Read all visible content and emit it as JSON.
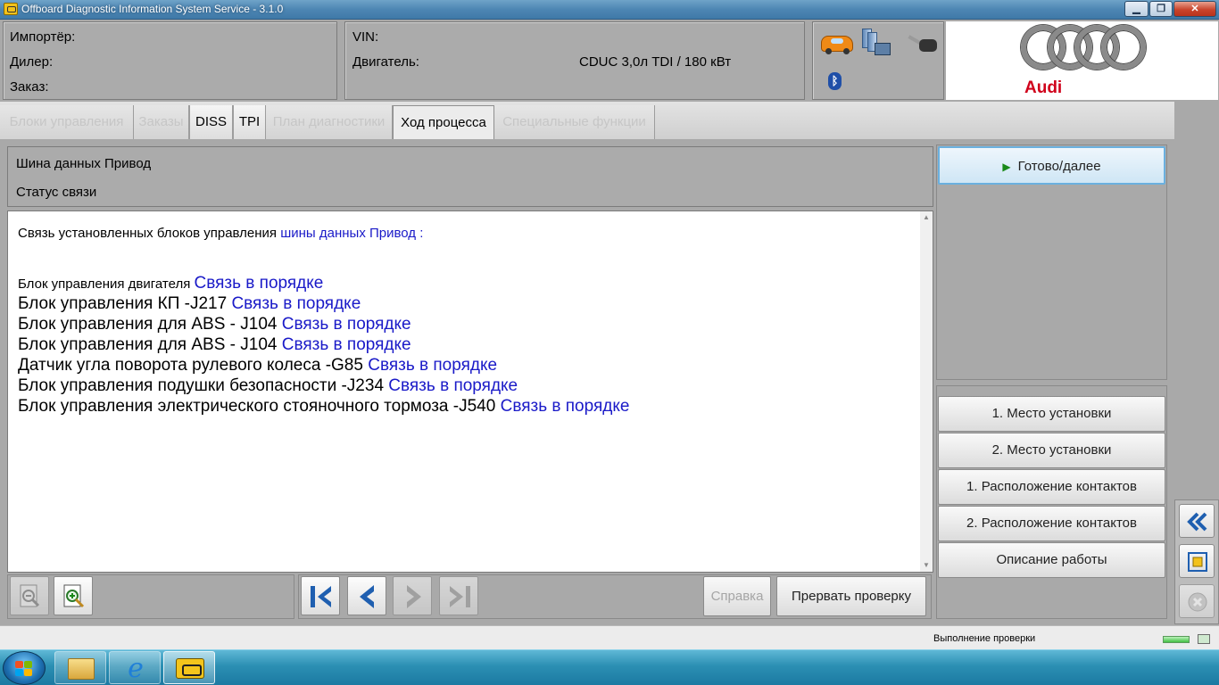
{
  "window": {
    "title": "Offboard Diagnostic Information System Service - 3.1.0",
    "min_label": "▁",
    "max_label": "❐",
    "close_label": "✕"
  },
  "header": {
    "importer_label": "Импортёр:",
    "dealer_label": "Дилер:",
    "order_label": "Заказ:",
    "vin_label": "VIN:",
    "engine_label": "Двигатель:",
    "engine_value": "CDUC 3,0л TDI / 180 кВт",
    "logo_text": "Audi",
    "icons": [
      "car-icon",
      "network-icon",
      "key-icon",
      "bluetooth-icon"
    ],
    "bluetooth_glyph": "ᛒ"
  },
  "tabs": [
    {
      "label": "Блоки управления",
      "state": "disabled"
    },
    {
      "label": "Заказы",
      "state": "disabled"
    },
    {
      "label": "DISS",
      "state": "enabled"
    },
    {
      "label": "TPI",
      "state": "enabled"
    },
    {
      "label": "План диагностики",
      "state": "disabled"
    },
    {
      "label": "Ход процесса",
      "state": "active"
    },
    {
      "label": "Специальные функции",
      "state": "disabled"
    }
  ],
  "info": {
    "title": "Шина данных Привод",
    "subtitle": "Статус связи"
  },
  "content": {
    "intro_text": "Связь установленных блоков управления ",
    "intro_link": "шины данных Привод :",
    "status_text": "Связь в порядке",
    "rows": [
      {
        "label": "Блок управления двигателя "
      },
      {
        "label": "Блок управления КП -J217 "
      },
      {
        "label": "Блок управления для ABS - J104 "
      },
      {
        "label": "Блок управления для ABS - J104 "
      },
      {
        "label": "Датчик угла поворота рулевого колеса -G85 "
      },
      {
        "label": "Блок управления подушки безопасности -J234 "
      },
      {
        "label": "Блок управления электрического стояночного тормоза  -J540 "
      }
    ]
  },
  "right_panel": {
    "next_label": "Готово/далее",
    "buttons": [
      "1. Место установки",
      "2. Место установки",
      "1. Расположение контактов",
      "2. Расположение контактов",
      "Описание работы"
    ]
  },
  "toolbar": {
    "help_label": "Справка",
    "abort_label": "Прервать проверку"
  },
  "status": {
    "text": "Выполнение проверки"
  },
  "colors": {
    "link": "#1a1ac8",
    "panel": "#ababab",
    "audi_red": "#d0021b"
  }
}
